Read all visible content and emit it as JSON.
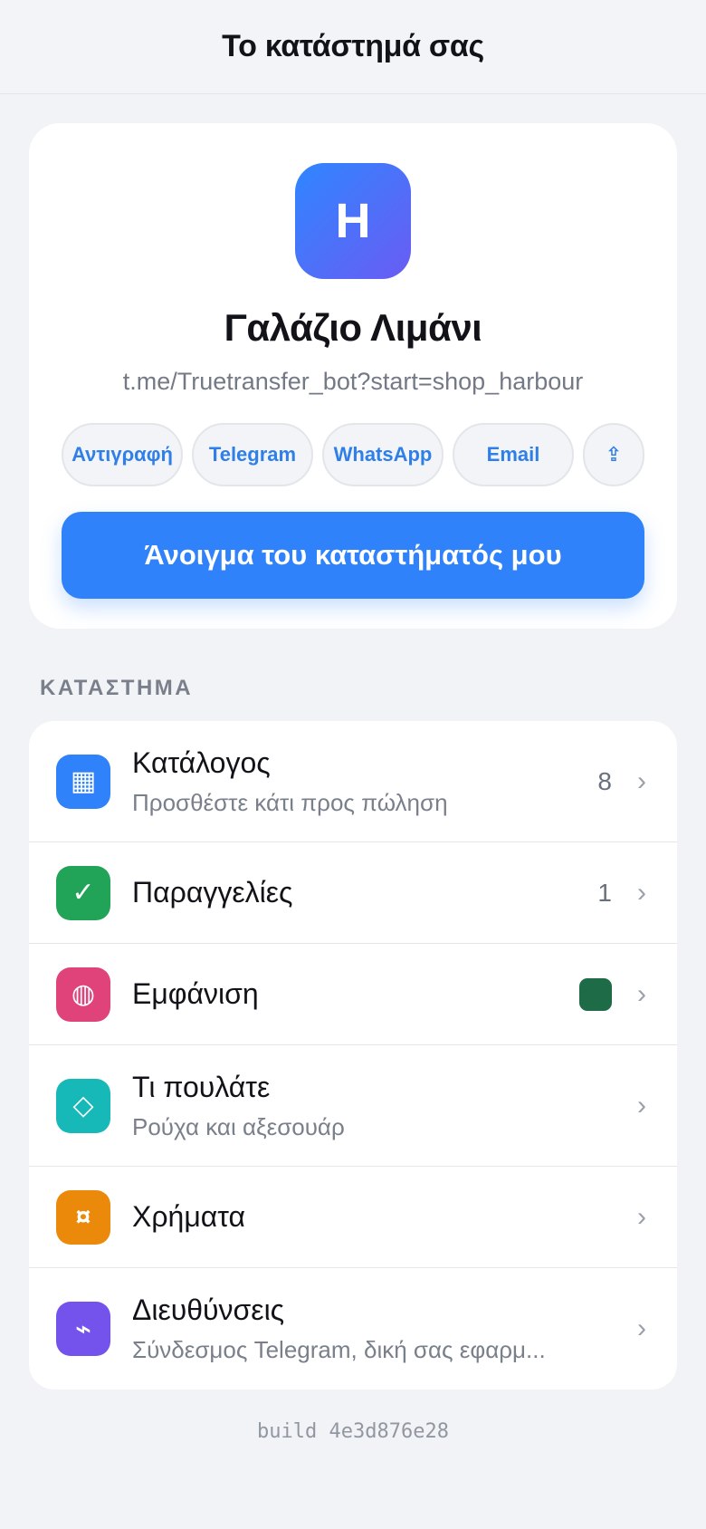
{
  "header": {
    "title": "Το κατάστημά σας"
  },
  "shop": {
    "logo_letter": "H",
    "name": "Γαλάζιο Λιμάνι",
    "link": "t.me/Truetransfer_bot?start=shop_harbour",
    "share_buttons": [
      {
        "label": "Αντιγραφή"
      },
      {
        "label": "Telegram"
      },
      {
        "label": "WhatsApp"
      },
      {
        "label": "Email"
      },
      {
        "icon": "share-icon",
        "glyph": "⇪"
      }
    ],
    "open_button_label": "Άνοιγμα του καταστήματός μου",
    "logo_gradient": [
      "#2f86ff",
      "#6a5cf3"
    ]
  },
  "store_section": {
    "label": "ΚΑΤΑΣΤΗΜΑ",
    "items": [
      {
        "title": "Κατάλογος",
        "subtitle": "Προσθέστε κάτι προς πώληση",
        "count": "8",
        "icon": "grid-icon",
        "glyph": "▦",
        "color": "#2f82fa"
      },
      {
        "title": "Παραγγελίες",
        "count": "1",
        "icon": "check-icon",
        "glyph": "✓",
        "color": "#22a458"
      },
      {
        "title": "Εμφάνιση",
        "icon": "palette-icon",
        "glyph": "◍",
        "color": "#e0427a",
        "swatch": "#1e6b48"
      },
      {
        "title": "Τι πουλάτε",
        "subtitle": "Ρούχα και αξεσουάρ",
        "icon": "diamond-icon",
        "glyph": "◇",
        "color": "#17b8b8"
      },
      {
        "title": "Χρήματα",
        "icon": "currency-icon",
        "glyph": "¤",
        "color": "#eb8a0a"
      },
      {
        "title": "Διευθύνσεις",
        "subtitle": "Σύνδεσμος Telegram, δική σας εφαρμ...",
        "icon": "link-icon",
        "glyph": "⌁",
        "color": "#7452ec"
      }
    ],
    "chevron": "›"
  },
  "footer": {
    "build": "build 4e3d876e28"
  }
}
